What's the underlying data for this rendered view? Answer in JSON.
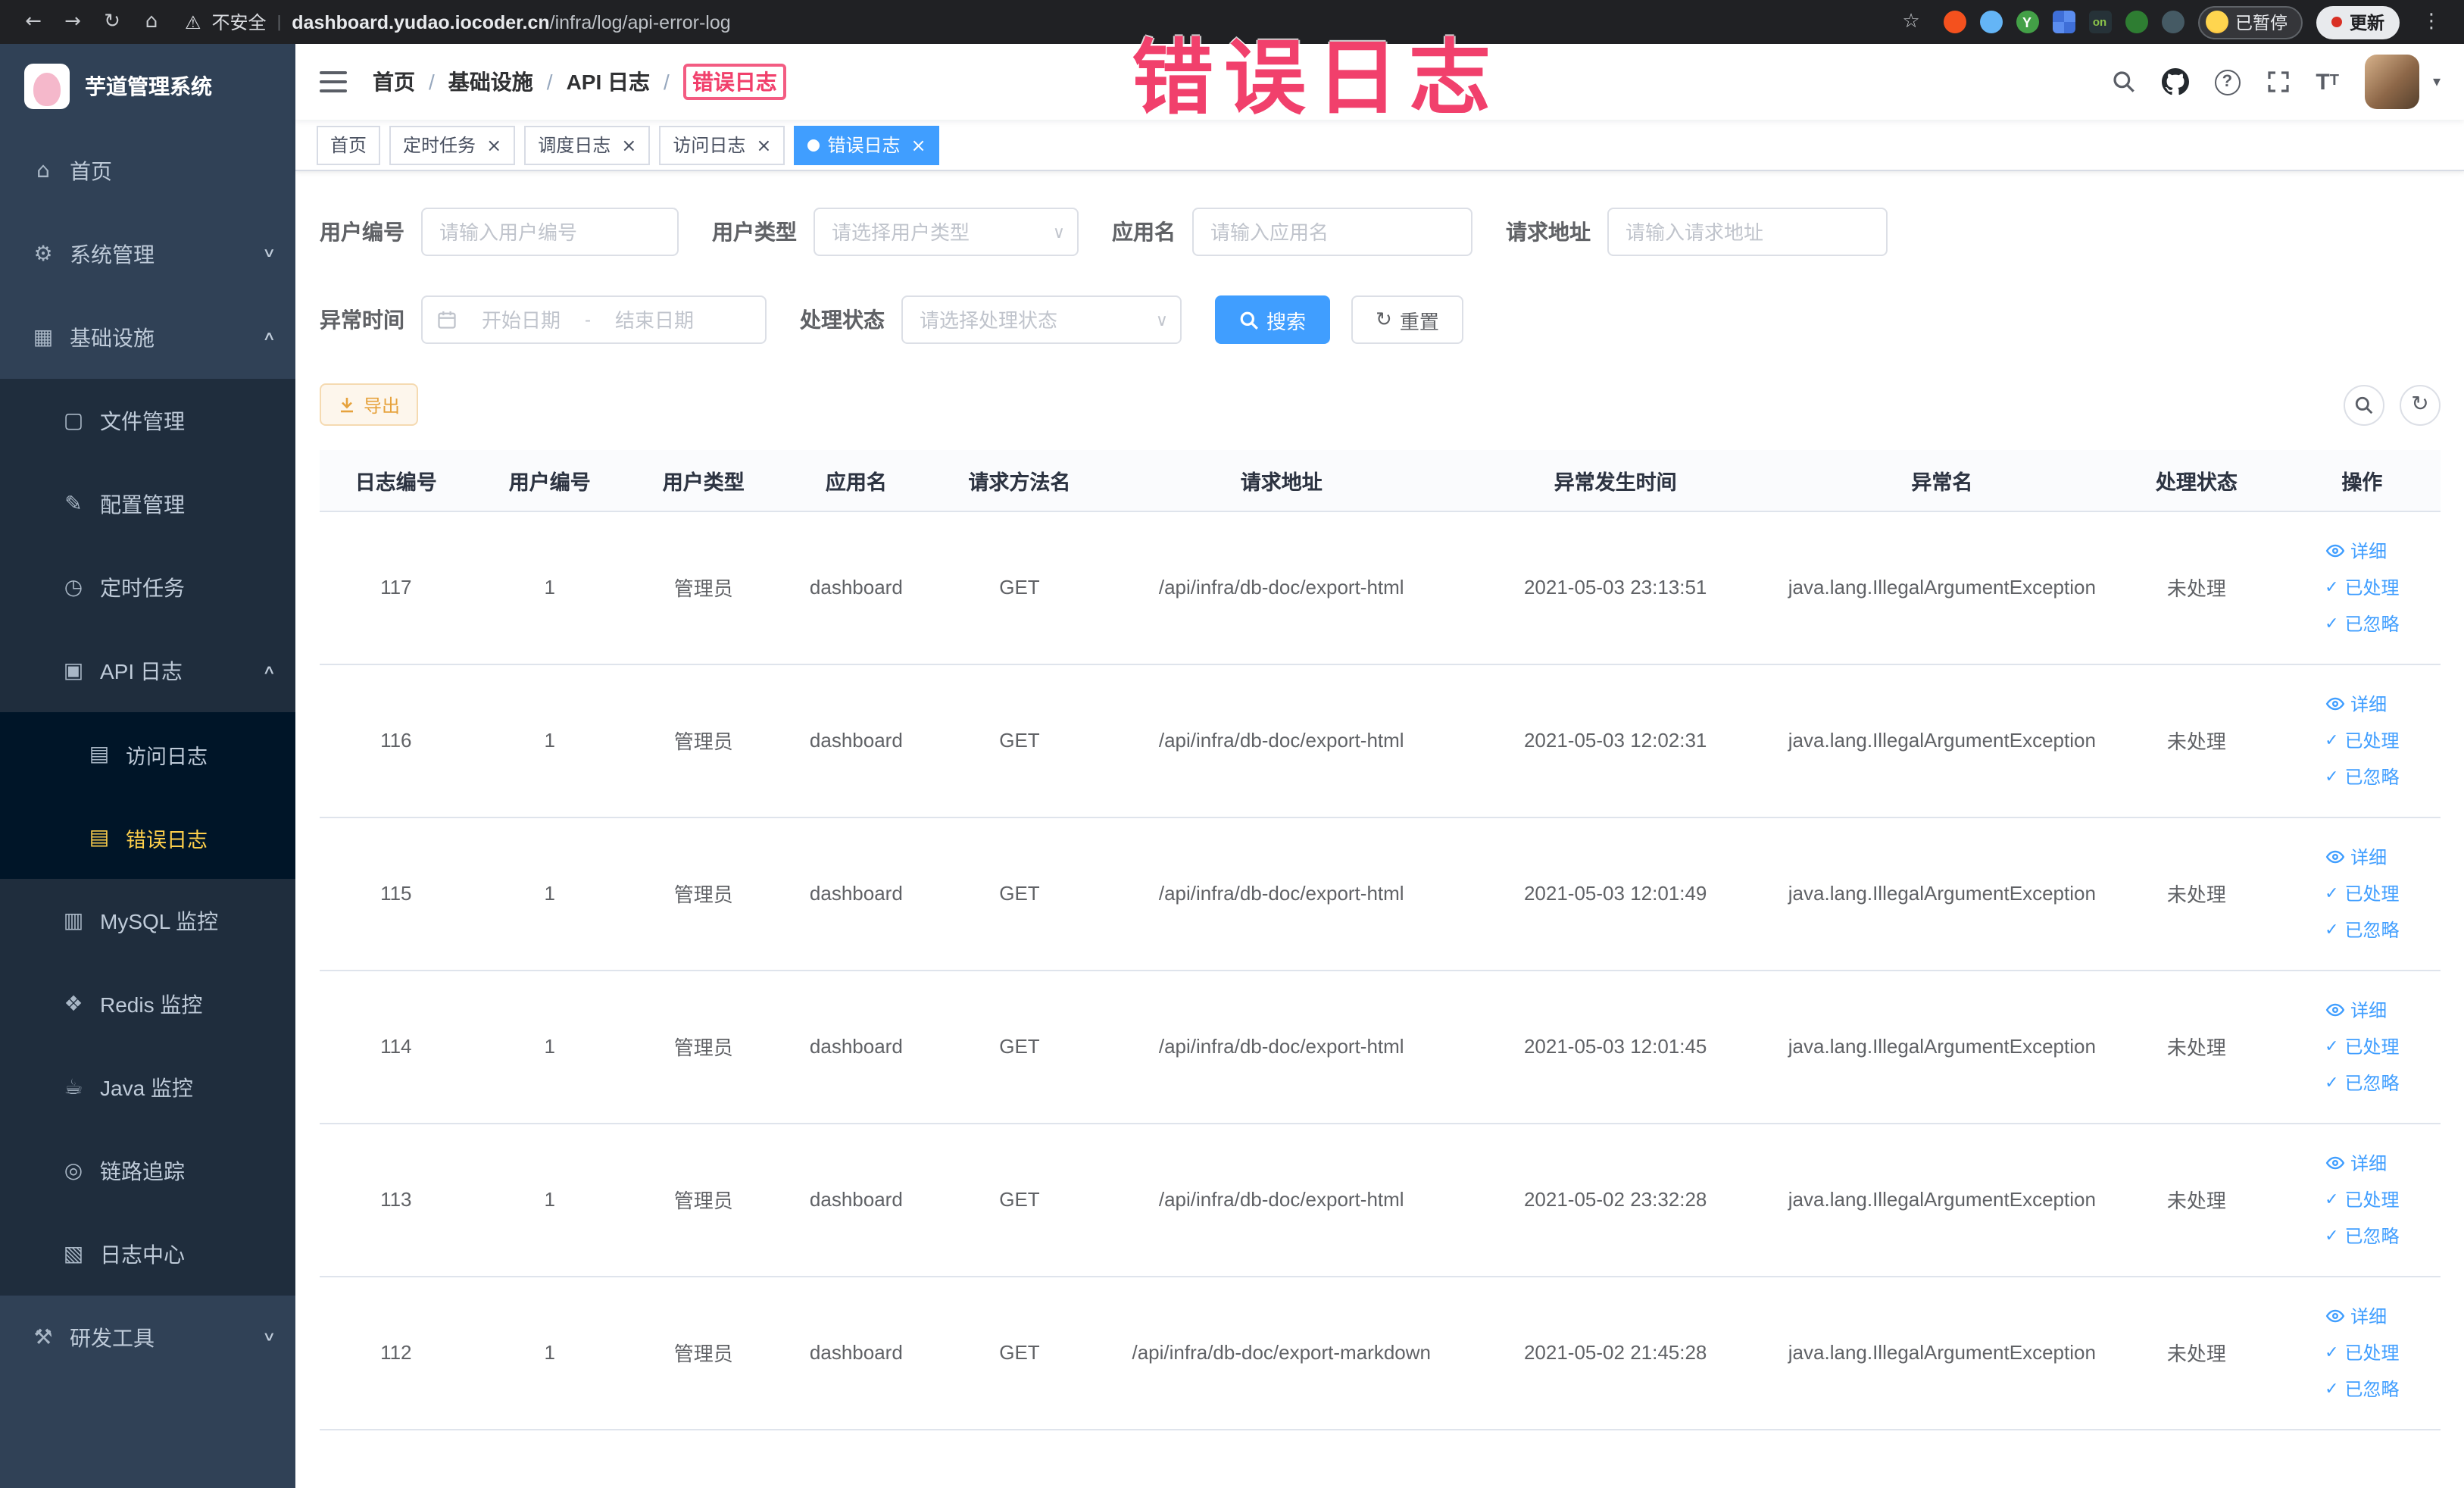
{
  "chrome": {
    "security_label": "不安全",
    "url_domain": "dashboard.yudao.iocoder.cn",
    "url_path": "/infra/log/api-error-log",
    "profile_label": "已暂停",
    "update_label": "更新"
  },
  "icons": {
    "back": "←",
    "forward": "→",
    "reload": "↻",
    "home": "⌂",
    "star": "☆",
    "overflow": "⋮",
    "warning": "⚠",
    "pipe": "|",
    "gear": "⚙",
    "grid": "▦",
    "file": "▢",
    "edit": "✎",
    "clock": "◷",
    "api": "▣",
    "doc": "▤",
    "db": "▥",
    "redis": "❖",
    "java": "☕",
    "eye": "◎",
    "log": "▧",
    "tool": "⚒",
    "chevron_down": "∨",
    "chevron_up": "∧",
    "close": "×",
    "caret_down": "▾",
    "question": "?",
    "refresh": "↻",
    "check": "✓",
    "view": "◉",
    "font_big": "T",
    "font_small": "T",
    "on_badge": "on",
    "ext_letter": "Y"
  },
  "annotation": {
    "title": "错误日志"
  },
  "sidebar": {
    "logo_title": "芋道管理系统",
    "items": [
      {
        "key": "home",
        "label": "首页",
        "icon": "home",
        "level": 1
      },
      {
        "key": "system",
        "label": "系统管理",
        "icon": "gear",
        "level": 1,
        "arrow": "down"
      },
      {
        "key": "infra",
        "label": "基础设施",
        "icon": "grid",
        "level": 1,
        "arrow": "up"
      },
      {
        "key": "file",
        "label": "文件管理",
        "icon": "file",
        "level": 2
      },
      {
        "key": "config",
        "label": "配置管理",
        "icon": "edit",
        "level": 2
      },
      {
        "key": "job",
        "label": "定时任务",
        "icon": "clock",
        "level": 2
      },
      {
        "key": "api-log",
        "label": "API 日志",
        "icon": "api",
        "level": 2,
        "arrow": "up"
      },
      {
        "key": "access-log",
        "label": "访问日志",
        "icon": "doc",
        "level": 3
      },
      {
        "key": "error-log",
        "label": "错误日志",
        "icon": "doc",
        "level": 3,
        "active": true
      },
      {
        "key": "mysql",
        "label": "MySQL 监控",
        "icon": "db",
        "level": 2
      },
      {
        "key": "redis",
        "label": "Redis 监控",
        "icon": "redis",
        "level": 2
      },
      {
        "key": "java",
        "label": "Java 监控",
        "icon": "java",
        "level": 2
      },
      {
        "key": "trace",
        "label": "链路追踪",
        "icon": "eye",
        "level": 2
      },
      {
        "key": "log-center",
        "label": "日志中心",
        "icon": "log",
        "level": 2
      },
      {
        "key": "devtool",
        "label": "研发工具",
        "icon": "tool",
        "level": 1,
        "arrow": "down"
      }
    ]
  },
  "navbar": {
    "breadcrumb": [
      "首页",
      "基础设施",
      "API 日志",
      "错误日志"
    ],
    "separator": "/"
  },
  "tabs": [
    {
      "key": "home",
      "label": "首页",
      "closable": false,
      "active": false
    },
    {
      "key": "job",
      "label": "定时任务",
      "closable": true,
      "active": false
    },
    {
      "key": "job-log",
      "label": "调度日志",
      "closable": true,
      "active": false
    },
    {
      "key": "access-log",
      "label": "访问日志",
      "closable": true,
      "active": false
    },
    {
      "key": "error-log",
      "label": "错误日志",
      "closable": true,
      "active": true
    }
  ],
  "filters": {
    "user_id_label": "用户编号",
    "user_id_placeholder": "请输入用户编号",
    "user_type_label": "用户类型",
    "user_type_placeholder": "请选择用户类型",
    "app_name_label": "应用名",
    "app_name_placeholder": "请输入应用名",
    "request_url_label": "请求地址",
    "request_url_placeholder": "请输入请求地址",
    "exception_time_label": "异常时间",
    "date_start_placeholder": "开始日期",
    "date_separator": "-",
    "date_end_placeholder": "结束日期",
    "process_status_label": "处理状态",
    "process_status_placeholder": "请选择处理状态",
    "search_label": "搜索",
    "reset_label": "重置"
  },
  "toolbar": {
    "export_label": "导出"
  },
  "table": {
    "headers": [
      "日志编号",
      "用户编号",
      "用户类型",
      "应用名",
      "请求方法名",
      "请求地址",
      "异常发生时间",
      "异常名",
      "处理状态",
      "操作"
    ],
    "columns": [
      "id",
      "user_id",
      "user_type",
      "app_name",
      "method",
      "url",
      "time",
      "exception",
      "status"
    ],
    "action_labels": {
      "detail": "详细",
      "processed": "已处理",
      "ignored": "已忽略"
    },
    "rows": [
      {
        "id": "117",
        "user_id": "1",
        "user_type": "管理员",
        "app_name": "dashboard",
        "method": "GET",
        "url": "/api/infra/db-doc/export-html",
        "time": "2021-05-03 23:13:51",
        "exception": "java.lang.IllegalArgumentException",
        "status": "未处理"
      },
      {
        "id": "116",
        "user_id": "1",
        "user_type": "管理员",
        "app_name": "dashboard",
        "method": "GET",
        "url": "/api/infra/db-doc/export-html",
        "time": "2021-05-03 12:02:31",
        "exception": "java.lang.IllegalArgumentException",
        "status": "未处理"
      },
      {
        "id": "115",
        "user_id": "1",
        "user_type": "管理员",
        "app_name": "dashboard",
        "method": "GET",
        "url": "/api/infra/db-doc/export-html",
        "time": "2021-05-03 12:01:49",
        "exception": "java.lang.IllegalArgumentException",
        "status": "未处理"
      },
      {
        "id": "114",
        "user_id": "1",
        "user_type": "管理员",
        "app_name": "dashboard",
        "method": "GET",
        "url": "/api/infra/db-doc/export-html",
        "time": "2021-05-03 12:01:45",
        "exception": "java.lang.IllegalArgumentException",
        "status": "未处理"
      },
      {
        "id": "113",
        "user_id": "1",
        "user_type": "管理员",
        "app_name": "dashboard",
        "method": "GET",
        "url": "/api/infra/db-doc/export-html",
        "time": "2021-05-02 23:32:28",
        "exception": "java.lang.IllegalArgumentException",
        "status": "未处理"
      },
      {
        "id": "112",
        "user_id": "1",
        "user_type": "管理员",
        "app_name": "dashboard",
        "method": "GET",
        "url": "/api/infra/db-doc/export-markdown",
        "time": "2021-05-02 21:45:28",
        "exception": "java.lang.IllegalArgumentException",
        "status": "未处理"
      }
    ]
  }
}
